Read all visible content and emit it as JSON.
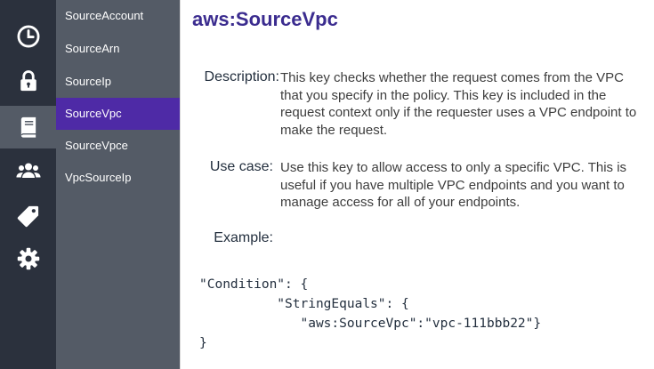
{
  "nav_rail": {
    "items": [
      {
        "icon": "clock-icon",
        "active": false
      },
      {
        "icon": "lock-icon",
        "active": false
      },
      {
        "icon": "book-icon",
        "active": true
      },
      {
        "icon": "users-icon",
        "active": false
      },
      {
        "icon": "tag-icon",
        "active": false
      },
      {
        "icon": "gear-icon",
        "active": false
      }
    ],
    "colors": {
      "background": "#2b313d",
      "active": "#545b66",
      "icon": "#ffffff"
    }
  },
  "key_list": {
    "items": [
      {
        "label": "SourceAccount",
        "active": false
      },
      {
        "label": "SourceArn",
        "active": false
      },
      {
        "label": "SourceIp",
        "active": false
      },
      {
        "label": "SourceVpc",
        "active": true
      },
      {
        "label": "SourceVpce",
        "active": false
      },
      {
        "label": "VpcSourceIp",
        "active": false
      }
    ],
    "colors": {
      "background": "#545b66",
      "active": "#4e2aa6"
    }
  },
  "detail": {
    "title": "aws:SourceVpc",
    "description_label": "Description:",
    "description": "This key checks whether the request comes from the VPC that you specify in the policy. This key is included in the request context only if the requester uses a VPC endpoint to make the request.",
    "use_case_label": "Use case:",
    "use_case": "Use this key to allow access to only a specific VPC. This is useful if you have multiple VPC endpoints and you want to manage access for all of your endpoints.",
    "example_label": "Example:",
    "example_code": [
      "\"Condition\": {",
      "          \"StringEquals\": {",
      "             \"aws:SourceVpc\":\"vpc-111bbb22\"}",
      "}"
    ],
    "colors": {
      "title": "#3b2c8f"
    }
  }
}
